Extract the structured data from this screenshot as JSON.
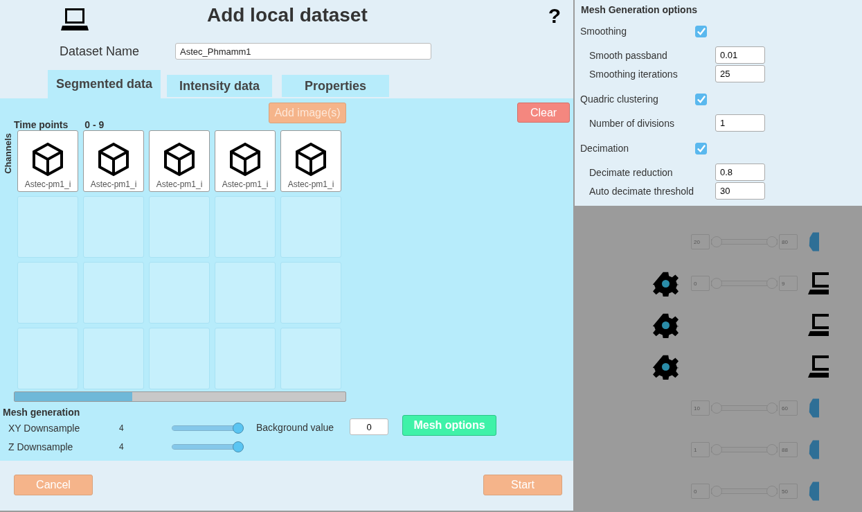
{
  "dialog": {
    "title": "Add local dataset",
    "help": "?",
    "dataset_name": {
      "label": "Dataset Name",
      "value": "Astec_Phmamm1"
    },
    "tabs": [
      {
        "label": "Segmented data",
        "selected": true
      },
      {
        "label": "Intensity data",
        "selected": false
      },
      {
        "label": "Properties",
        "selected": false
      }
    ],
    "add_button": "Add image(s)",
    "clear_button": "Clear",
    "time_points": {
      "label": "Time points",
      "range": "0 - 9"
    },
    "channels_label": "Channels",
    "grid": [
      [
        {
          "kind": "image",
          "label": "Astec-pm1_i"
        },
        {
          "kind": "image",
          "label": "Astec-pm1_i"
        },
        {
          "kind": "image",
          "label": "Astec-pm1_i"
        },
        {
          "kind": "image",
          "label": "Astec-pm1_i"
        },
        {
          "kind": "image",
          "label": "Astec-pm1_i"
        }
      ],
      [
        {
          "kind": "empty"
        },
        {
          "kind": "empty"
        },
        {
          "kind": "empty"
        },
        {
          "kind": "empty"
        },
        {
          "kind": "empty"
        }
      ],
      [
        {
          "kind": "empty"
        },
        {
          "kind": "empty"
        },
        {
          "kind": "empty"
        },
        {
          "kind": "empty"
        },
        {
          "kind": "empty"
        }
      ],
      [
        {
          "kind": "empty"
        },
        {
          "kind": "empty"
        },
        {
          "kind": "empty"
        },
        {
          "kind": "empty"
        },
        {
          "kind": "empty"
        }
      ]
    ],
    "mesh_generation": {
      "title": "Mesh generation",
      "sliders": [
        {
          "label": "XY Downsample",
          "reading": "4",
          "level": 1
        },
        {
          "label": "Z Downsample",
          "reading": "4",
          "level": 1
        }
      ],
      "background": {
        "label": "Background value",
        "value": "0"
      },
      "options_button": "Mesh options"
    },
    "cancel_button": "Cancel",
    "start_button": "Start"
  },
  "mesh_options": {
    "title": "Mesh Generation options",
    "groups": [
      {
        "label": "Smoothing",
        "checked": true,
        "fields": [
          {
            "label": "Smooth passband",
            "value": "0.01"
          },
          {
            "label": "Smoothing iterations",
            "value": "25"
          }
        ]
      },
      {
        "label": "Quadric clustering",
        "checked": true,
        "fields": [
          {
            "label": "Number of divisions",
            "value": "1"
          }
        ]
      },
      {
        "label": "Decimation",
        "checked": true,
        "fields": [
          {
            "label": "Decimate reduction",
            "value": "0.8"
          },
          {
            "label": "Auto decimate threshold",
            "value": "30"
          }
        ]
      }
    ]
  },
  "background_rows": [
    {
      "kind": "blob",
      "gear": false,
      "min": "20",
      "max": "80",
      "level": 1
    },
    {
      "kind": "laptop",
      "gear": true,
      "min": "0",
      "max": "9",
      "level": 1
    },
    {
      "kind": "laptop",
      "gear": true
    },
    {
      "kind": "laptop",
      "gear": true
    },
    {
      "kind": "blob",
      "gear": false,
      "min": "10",
      "max": "60",
      "level": 1
    },
    {
      "kind": "blob",
      "gear": false,
      "min": "1",
      "max": "88",
      "level": 1
    },
    {
      "kind": "blob",
      "gear": false,
      "min": "0",
      "max": "50",
      "level": 1
    }
  ]
}
